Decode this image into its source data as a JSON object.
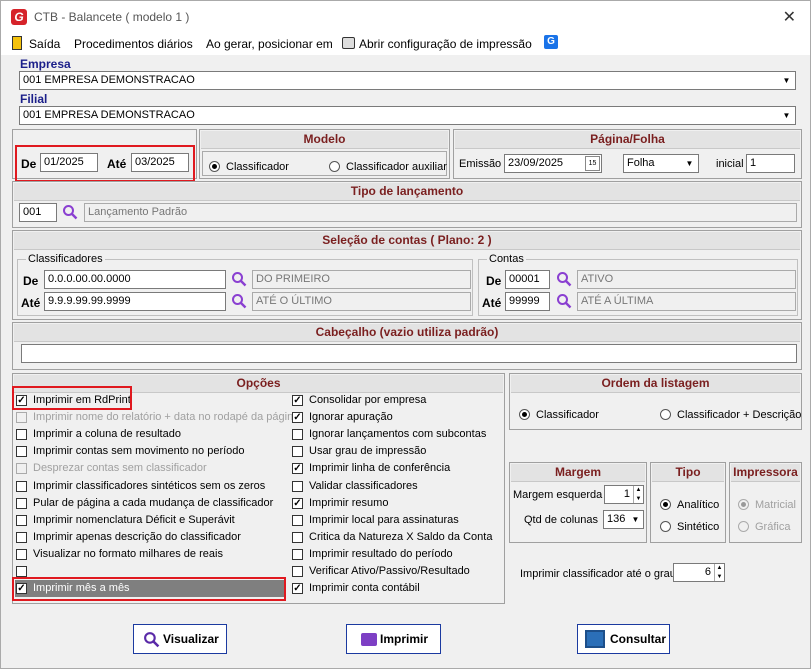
{
  "window": {
    "title": "CTB - Balancete  ( modelo 1 )",
    "close": "✕"
  },
  "menu": {
    "sair": "Saída",
    "procedimentos": "Procedimentos diários",
    "gerar": "Ao gerar, posicionar em",
    "config": "Abrir configuração de impressão"
  },
  "empresa": {
    "label": "Empresa",
    "value": "001 EMPRESA DEMONSTRACAO"
  },
  "filial": {
    "label": "Filial",
    "value": "001 EMPRESA DEMONSTRACAO"
  },
  "periodo": {
    "de_label": "De",
    "de": "01/2025",
    "ate_label": "Até",
    "ate": "03/2025"
  },
  "modelo": {
    "title": "Modelo",
    "opt1": "Classificador",
    "opt2": "Classificador auxiliar"
  },
  "pagina": {
    "title": "Página/Folha",
    "emissao_label": "Emissão",
    "emissao": "23/09/2025",
    "folha": "Folha",
    "inicial_label": "inicial",
    "inicial": "1"
  },
  "tipo_lancamento": {
    "title": "Tipo de lançamento",
    "code": "001",
    "desc": "Lançamento Padrão"
  },
  "selecao": {
    "title": "Seleção de contas  ( Plano: 2 )",
    "class_title": "Classificadores",
    "contas_title": "Contas",
    "de_label": "De",
    "ate_label": "Até",
    "class_de": "0.0.0.00.00.0000",
    "class_de_desc": "DO PRIMEIRO",
    "class_ate": "9.9.9.99.99.9999",
    "class_ate_desc": "ATÉ O ÚLTIMO",
    "conta_de": "00001",
    "conta_de_desc": "ATIVO",
    "conta_ate": "99999",
    "conta_ate_desc": "ATÉ A ÚLTIMA"
  },
  "cabecalho": {
    "title": "Cabeçalho (vazio utiliza padrão)",
    "value": ""
  },
  "opcoes": {
    "title": "Opções",
    "left": [
      {
        "label": "Imprimir em RdPrint",
        "checked": true,
        "enabled": true
      },
      {
        "label": "Imprimir nome do relatório + data no rodapé da página",
        "checked": false,
        "enabled": false
      },
      {
        "label": "Imprimir a coluna de resultado",
        "checked": false,
        "enabled": true
      },
      {
        "label": "Imprimir contas sem movimento no período",
        "checked": false,
        "enabled": true
      },
      {
        "label": "Desprezar contas sem classificador",
        "checked": false,
        "enabled": false
      },
      {
        "label": "Imprimir classificadores sintéticos sem os zeros",
        "checked": false,
        "enabled": true
      },
      {
        "label": "Pular de página a cada mudança de classificador",
        "checked": false,
        "enabled": true
      },
      {
        "label": "Imprimir nomenclatura Déficit e Superávit",
        "checked": false,
        "enabled": true
      },
      {
        "label": "Imprimir apenas descrição do classificador",
        "checked": false,
        "enabled": true
      },
      {
        "label": "Visualizar no formato milhares de reais",
        "checked": false,
        "enabled": true
      },
      {
        "label": "",
        "checked": false,
        "enabled": true
      },
      {
        "label": "Imprimir mês a mês",
        "checked": true,
        "enabled": true
      }
    ],
    "right": [
      {
        "label": "Consolidar por empresa",
        "checked": true
      },
      {
        "label": "Ignorar apuração",
        "checked": true
      },
      {
        "label": "Ignorar lançamentos com subcontas",
        "checked": false
      },
      {
        "label": "Usar grau de impressão",
        "checked": false
      },
      {
        "label": "Imprimir linha de conferência",
        "checked": true
      },
      {
        "label": "Validar classificadores",
        "checked": false
      },
      {
        "label": "Imprimir resumo",
        "checked": true
      },
      {
        "label": "Imprimir local para assinaturas",
        "checked": false
      },
      {
        "label": "Critica da Natureza X Saldo da Conta",
        "checked": false
      },
      {
        "label": "Imprimir resultado do período",
        "checked": false
      },
      {
        "label": "Verificar Ativo/Passivo/Resultado",
        "checked": false
      },
      {
        "label": "Imprimir conta contábil",
        "checked": true
      }
    ]
  },
  "ordem": {
    "title": "Ordem da listagem",
    "opt1": "Classificador",
    "opt2": "Classificador + Descrição"
  },
  "margem": {
    "title": "Margem",
    "esq_label": "Margem esquerda",
    "esq": "1",
    "qtd_label": "Qtd de colunas",
    "qtd": "136"
  },
  "tipo": {
    "title": "Tipo",
    "opt1": "Analítico",
    "opt2": "Sintético"
  },
  "impressora": {
    "title": "Impressora",
    "opt1": "Matricial",
    "opt2": "Gráfica"
  },
  "grau": {
    "label": "Imprimir classificador até o grau",
    "value": "6"
  },
  "buttons": {
    "visualizar": "Visualizar",
    "imprimir": "Imprimir",
    "consultar": "Consultar"
  },
  "colors": {
    "accent": "#e0191f",
    "header_text": "#7a1f1f",
    "label_blue": "#1b1f8a"
  }
}
